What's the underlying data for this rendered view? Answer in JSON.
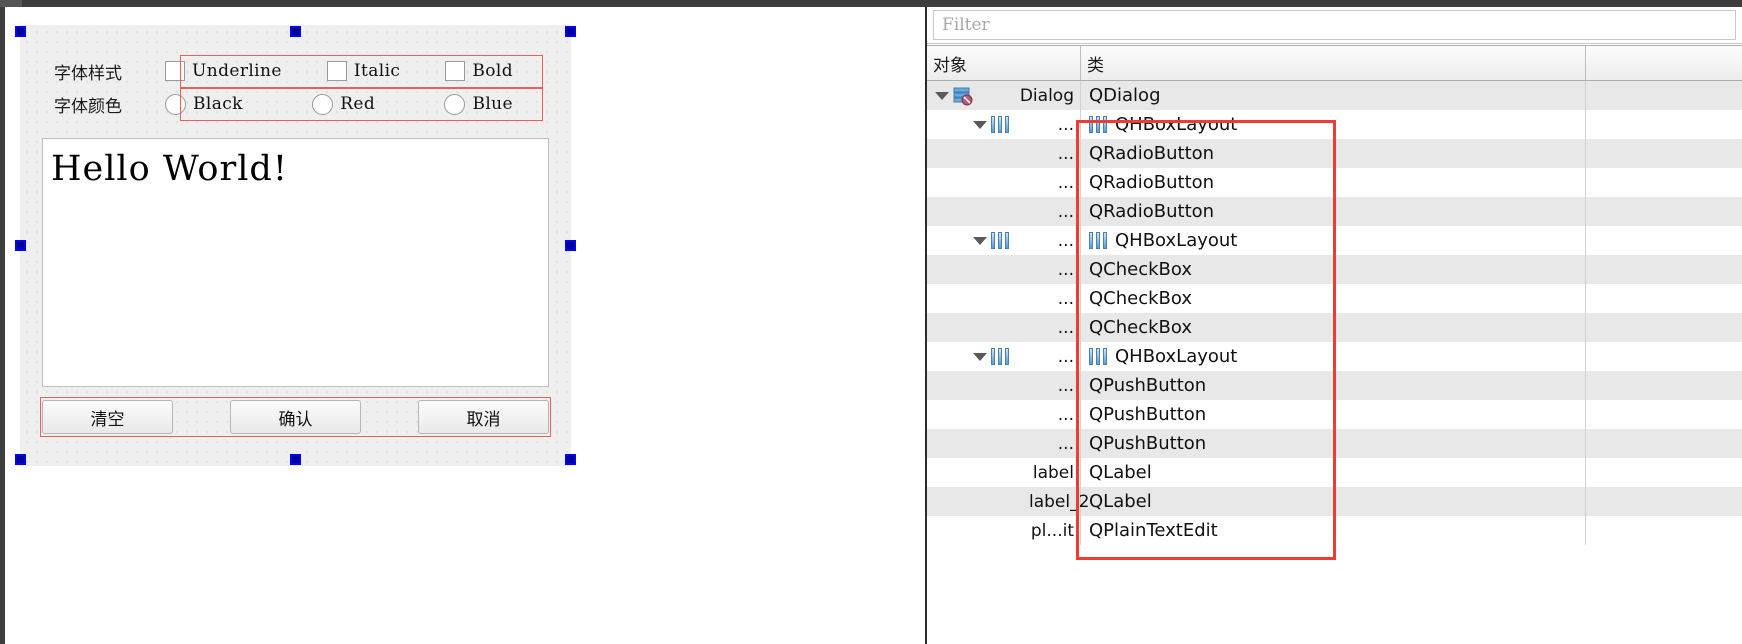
{
  "window": {
    "title_bar_color": "#3d3d3d"
  },
  "designer": {
    "form": {
      "style_row": {
        "label": "字体样式",
        "options": [
          {
            "caption": "Underline",
            "control": "checkbox",
            "checked": false
          },
          {
            "caption": "Italic",
            "control": "checkbox",
            "checked": false
          },
          {
            "caption": "Bold",
            "control": "checkbox",
            "checked": false
          }
        ]
      },
      "color_row": {
        "label": "字体颜色",
        "options": [
          {
            "caption": "Black",
            "control": "radio",
            "checked": false
          },
          {
            "caption": "Red",
            "control": "radio",
            "checked": false
          },
          {
            "caption": "Blue",
            "control": "radio",
            "checked": false
          }
        ]
      },
      "text_edit": {
        "value": "Hello World!",
        "placeholder": ""
      },
      "buttons": [
        {
          "label": "清空"
        },
        {
          "label": "确认"
        },
        {
          "label": "取消"
        }
      ]
    },
    "annotation_color": "#e8605a",
    "selection_handle_color": "#0000ff"
  },
  "inspector": {
    "filter": {
      "value": "",
      "placeholder": "Filter"
    },
    "columns": [
      {
        "label": "对象"
      },
      {
        "label": "类"
      },
      {
        "label": ""
      }
    ],
    "annotation_color": "#ef3b33",
    "rows": [
      {
        "object": "Dialog",
        "class": "QDialog",
        "depth": 0,
        "expandable": true,
        "icon": "dialog",
        "class_icon": "none",
        "shade": "alt"
      },
      {
        "object": "...",
        "class": "QHBoxLayout",
        "depth": 1,
        "expandable": true,
        "icon": "layout",
        "class_icon": "layout",
        "shade": "plain"
      },
      {
        "object": "...",
        "class": "QRadioButton",
        "depth": 2,
        "expandable": false,
        "icon": "none",
        "class_icon": "none",
        "shade": "alt"
      },
      {
        "object": "...",
        "class": "QRadioButton",
        "depth": 2,
        "expandable": false,
        "icon": "none",
        "class_icon": "none",
        "shade": "plain"
      },
      {
        "object": "...",
        "class": "QRadioButton",
        "depth": 2,
        "expandable": false,
        "icon": "none",
        "class_icon": "none",
        "shade": "alt"
      },
      {
        "object": "...",
        "class": "QHBoxLayout",
        "depth": 1,
        "expandable": true,
        "icon": "layout",
        "class_icon": "layout",
        "shade": "plain"
      },
      {
        "object": "...",
        "class": "QCheckBox",
        "depth": 2,
        "expandable": false,
        "icon": "none",
        "class_icon": "none",
        "shade": "alt"
      },
      {
        "object": "...",
        "class": "QCheckBox",
        "depth": 2,
        "expandable": false,
        "icon": "none",
        "class_icon": "none",
        "shade": "plain"
      },
      {
        "object": "...",
        "class": "QCheckBox",
        "depth": 2,
        "expandable": false,
        "icon": "none",
        "class_icon": "none",
        "shade": "alt"
      },
      {
        "object": "...",
        "class": "QHBoxLayout",
        "depth": 1,
        "expandable": true,
        "icon": "layout",
        "class_icon": "layout",
        "shade": "plain"
      },
      {
        "object": "...",
        "class": "QPushButton",
        "depth": 2,
        "expandable": false,
        "icon": "none",
        "class_icon": "none",
        "shade": "alt"
      },
      {
        "object": "...",
        "class": "QPushButton",
        "depth": 2,
        "expandable": false,
        "icon": "none",
        "class_icon": "none",
        "shade": "plain"
      },
      {
        "object": "...",
        "class": "QPushButton",
        "depth": 2,
        "expandable": false,
        "icon": "none",
        "class_icon": "none",
        "shade": "alt"
      },
      {
        "object": "label",
        "class": "QLabel",
        "depth": 2,
        "expandable": false,
        "icon": "none",
        "class_icon": "none",
        "shade": "plain"
      },
      {
        "object": "label_2",
        "class": "QLabel",
        "depth": 2,
        "expandable": false,
        "icon": "none",
        "class_icon": "none",
        "shade": "alt"
      },
      {
        "object": "pl...it",
        "class": "QPlainTextEdit",
        "depth": 2,
        "expandable": false,
        "icon": "none",
        "class_icon": "none",
        "shade": "plain"
      }
    ]
  }
}
